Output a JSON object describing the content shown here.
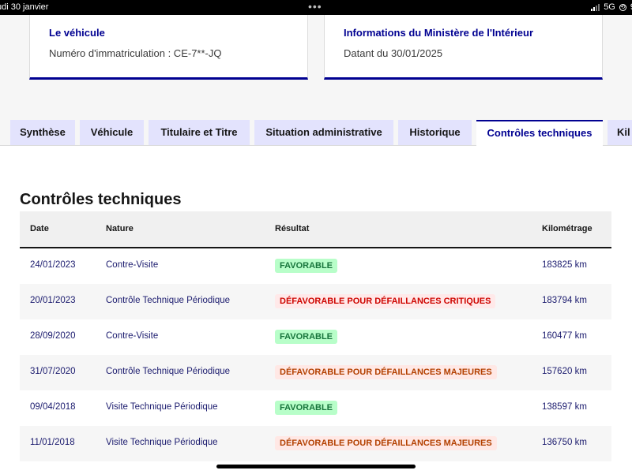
{
  "status_bar": {
    "date": "udi 30 janvier",
    "network": "5G",
    "battery_fragment": "9"
  },
  "cards": [
    {
      "title": "Le véhicule",
      "subtitle": "Numéro d'immatriculation : CE-7**-JQ"
    },
    {
      "title": "Informations du Ministère de l'Intérieur",
      "subtitle": "Datant du 30/01/2025"
    }
  ],
  "tabs": [
    {
      "label": "Synthèse",
      "active": false
    },
    {
      "label": "Véhicule",
      "active": false
    },
    {
      "label": "Titulaire et Titre",
      "active": false
    },
    {
      "label": "Situation administrative",
      "active": false
    },
    {
      "label": "Historique",
      "active": false
    },
    {
      "label": "Contrôles techniques",
      "active": true
    },
    {
      "label": "Kil",
      "active": false
    }
  ],
  "section": {
    "title": "Contrôles techniques"
  },
  "table": {
    "headers": [
      "Date",
      "Nature",
      "Résultat",
      "Kilométrage"
    ],
    "rows": [
      {
        "date": "24/01/2023",
        "nature": "Contre-Visite",
        "result": "FAVORABLE",
        "result_type": "ok",
        "km": "183825 km"
      },
      {
        "date": "20/01/2023",
        "nature": "Contrôle Technique Périodique",
        "result": "DÉFAVORABLE POUR DÉFAILLANCES CRITIQUES",
        "result_type": "crit",
        "km": "183794 km"
      },
      {
        "date": "28/09/2020",
        "nature": "Contre-Visite",
        "result": "FAVORABLE",
        "result_type": "ok",
        "km": "160477 km"
      },
      {
        "date": "31/07/2020",
        "nature": "Contrôle Technique Périodique",
        "result": "DÉFAVORABLE POUR DÉFAILLANCES MAJEURES",
        "result_type": "maj",
        "km": "157620 km"
      },
      {
        "date": "09/04/2018",
        "nature": "Visite Technique Périodique",
        "result": "FAVORABLE",
        "result_type": "ok",
        "km": "138597 km"
      },
      {
        "date": "11/01/2018",
        "nature": "Visite Technique Périodique",
        "result": "DÉFAVORABLE POUR DÉFAILLANCES MAJEURES",
        "result_type": "maj",
        "km": "136750 km"
      }
    ]
  },
  "colors": {
    "accent": "#000091",
    "favorable": "#18753c",
    "critical": "#ce0500",
    "major": "#b34000"
  }
}
